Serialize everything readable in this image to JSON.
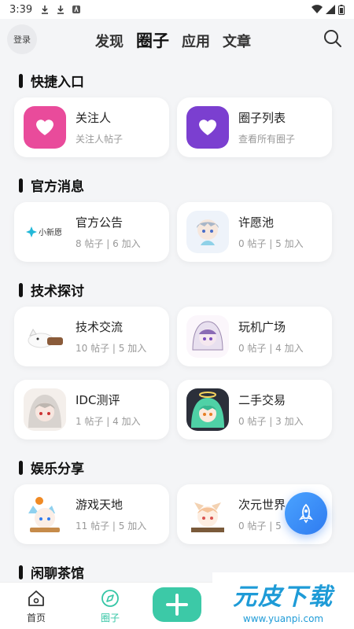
{
  "status": {
    "time": "3:39"
  },
  "header": {
    "login_label": "登录",
    "tabs": [
      {
        "label": "发现"
      },
      {
        "label": "圈子"
      },
      {
        "label": "应用"
      },
      {
        "label": "文章"
      }
    ]
  },
  "sections": [
    {
      "title": "快捷入口",
      "cards": [
        {
          "name": "关注人",
          "sub": "关注人帖子",
          "color": "#e94b9b",
          "icon": "heart-icon"
        },
        {
          "name": "圈子列表",
          "sub": "查看所有圈子",
          "color": "#7b3fd0",
          "icon": "heart-icon"
        }
      ]
    },
    {
      "title": "官方消息",
      "cards": [
        {
          "name": "官方公告",
          "sub": "8 帖子 | 6 加入",
          "icon": "logo-image",
          "logo_text": "小新愿"
        },
        {
          "name": "许愿池",
          "sub": "0 帖子 | 5 加入",
          "icon": "avatar-image"
        }
      ]
    },
    {
      "title": "技术探讨",
      "cards": [
        {
          "name": "技术交流",
          "sub": "10 帖子 | 5 加入",
          "icon": "avatar-image"
        },
        {
          "name": "玩机广场",
          "sub": "0 帖子 | 4 加入",
          "icon": "avatar-image"
        },
        {
          "name": "IDC测评",
          "sub": "1 帖子 | 4 加入",
          "icon": "avatar-image"
        },
        {
          "name": "二手交易",
          "sub": "0 帖子 | 3 加入",
          "icon": "avatar-image"
        }
      ]
    },
    {
      "title": "娱乐分享",
      "cards": [
        {
          "name": "游戏天地",
          "sub": "11 帖子 | 5 加入",
          "icon": "avatar-image"
        },
        {
          "name": "次元世界",
          "sub": "0 帖子 | 5",
          "icon": "avatar-image"
        }
      ]
    },
    {
      "title": "闲聊茶馆",
      "cards": []
    }
  ],
  "bottom_nav": {
    "home_label": "首页",
    "circle_label": "圈子"
  },
  "watermark": {
    "big": "元皮下载",
    "small": "www.yuanpi.com"
  },
  "colors": {
    "accent": "#3cc9a7",
    "fab": "#2f7bf0"
  }
}
